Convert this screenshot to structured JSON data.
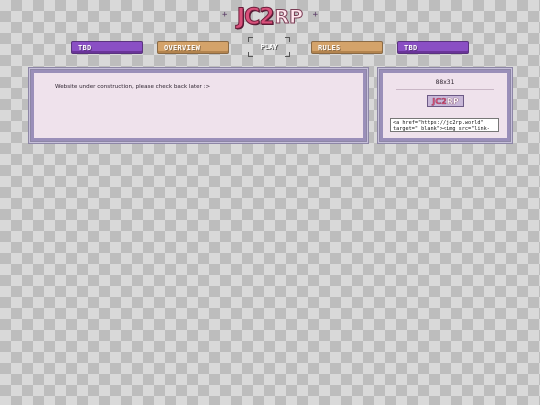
{
  "logo": {
    "main": "JC2",
    "suffix": "RP",
    "spark_left": "+",
    "spark_right": "+"
  },
  "nav": {
    "items": [
      {
        "label": "TBD",
        "color": "#8a4fc4"
      },
      {
        "label": "OVERVIEW",
        "color": "#d4a36a"
      },
      {
        "label": "PLAY",
        "color": "#ffffff"
      },
      {
        "label": "RULES",
        "color": "#d4a36a"
      },
      {
        "label": "TBD",
        "color": "#8a4fc4"
      }
    ]
  },
  "main": {
    "message": "Website under construction, please check back later :>"
  },
  "sidebar": {
    "badge_title": "88x31",
    "badge": {
      "main": "JC2",
      "suffix": "RP"
    },
    "embed_code": "<a href=\"https://jc2rp.world\"\ntarget=\"_blank\"><img src=\"link-"
  },
  "colors": {
    "panel": "#efe2ec",
    "frame": "#9a8fb9",
    "accent_pink": "#d9507a"
  }
}
